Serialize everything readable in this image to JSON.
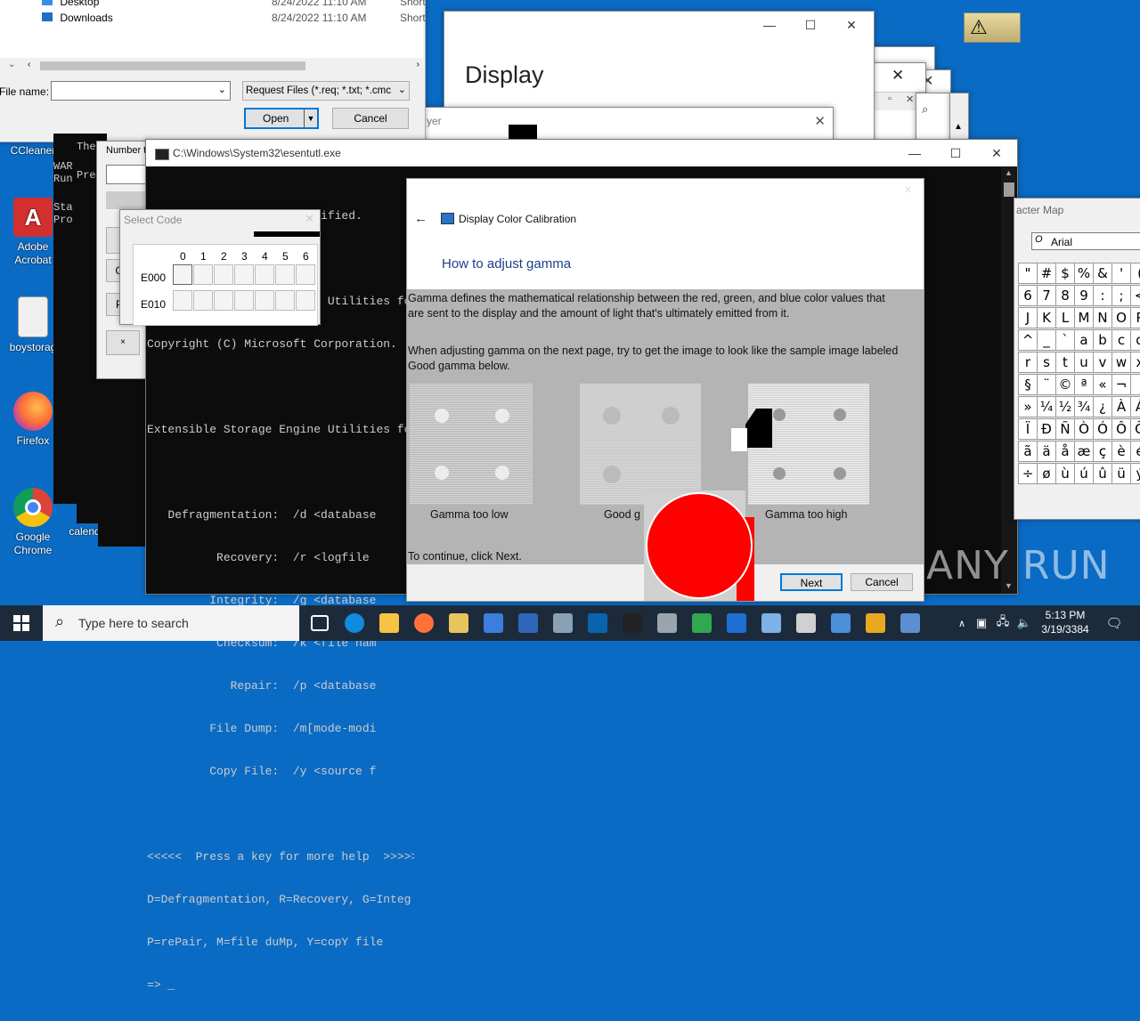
{
  "desktop": {
    "icons": [
      {
        "label": "CCleaner",
        "color": "#c62828"
      },
      {
        "label": "Adobe Acrobat",
        "color": "#d32f2f"
      },
      {
        "label": "boystorag",
        "color": "#e0e0e0"
      },
      {
        "label": "Firefox",
        "color": "#ff7139"
      },
      {
        "label": "Google Chrome",
        "color": "#4caf50"
      },
      {
        "label": "calend",
        "color": "#ffffff"
      }
    ]
  },
  "file_dialog": {
    "rows": [
      {
        "name": "Desktop",
        "date": "8/24/2022 11:10 AM",
        "type": "Short"
      },
      {
        "name": "Downloads",
        "date": "8/24/2022 11:10 AM",
        "type": "Short"
      }
    ],
    "filename_label": "File name:",
    "filename_value": "",
    "filter_value": "Request Files (*.req; *.txt; *.cmc",
    "open_label": "Open",
    "cancel_label": "Cancel"
  },
  "display_window": {
    "title": "Display",
    "search_text": "yer"
  },
  "cmd_window": {
    "title": "C:\\Windows\\System32\\esentutl.exe",
    "lines": [
      "Usage Error: No mode specified.",
      "",
      "Extensible Storage Engine Utilities for",
      "Copyright (C) Microsoft Corporation.",
      "",
      "Extensible Storage Engine Utilities for",
      "",
      "   Defragmentation:  /d <database",
      "          Recovery:  /r <logfile",
      "         Integrity:  /g <database",
      "          Checksum:  /k <file nam",
      "            Repair:  /p <database",
      "         File Dump:  /m[mode-modi",
      "         Copy File:  /y <source f",
      "",
      "<<<<<  Press a key for more help  >>>>>",
      "D=Defragmentation, R=Recovery, G=Integ",
      "P=rePair, M=file duMp, Y=copY file",
      "=> _"
    ]
  },
  "back_console": {
    "lines": [
      "The",
      "WAR",
      "Run",
      "",
      "Sta",
      "Pro"
    ],
    "lines2": [
      "Pre"
    ]
  },
  "number_window": {
    "label": "Number t"
  },
  "select_code": {
    "title": "Select Code",
    "columns": [
      "0",
      "1",
      "2",
      "3",
      "4",
      "5",
      "6"
    ],
    "rows": [
      "E000",
      "E010"
    ]
  },
  "calibration": {
    "title": "Display Color Calibration",
    "heading": "How to adjust gamma",
    "para1": "Gamma defines the mathematical relationship between the red, green, and blue color values that are sent to the display and the amount of light that's ultimately emitted from it.",
    "para2": "When adjusting gamma on the next page, try to get the image to look like the sample image labeled Good gamma below.",
    "samples": [
      {
        "label": "Gamma too low"
      },
      {
        "label": "Good g"
      },
      {
        "label": "Gamma too high"
      }
    ],
    "continue_text": "To continue, click Next.",
    "next_label": "Next",
    "cancel_label": "Cancel"
  },
  "charmap": {
    "title": "acter Map",
    "font": "Arial",
    "rows": [
      [
        "\"",
        "#",
        "$",
        "%",
        "&",
        "'",
        "("
      ],
      [
        "6",
        "7",
        "8",
        "9",
        ":",
        ";",
        "<"
      ],
      [
        "J",
        "K",
        "L",
        "M",
        "N",
        "O",
        "P"
      ],
      [
        "^",
        "_",
        "`",
        "a",
        "b",
        "c",
        "d"
      ],
      [
        "r",
        "s",
        "t",
        "u",
        "v",
        "w",
        "x"
      ],
      [
        "§",
        "¨",
        "©",
        "ª",
        "«",
        "¬",
        "­"
      ],
      [
        "»",
        "¼",
        "½",
        "¾",
        "¿",
        "À",
        "Á"
      ],
      [
        "Ï",
        "Ð",
        "Ñ",
        "Ò",
        "Ó",
        "Ô",
        "Õ"
      ],
      [
        "ã",
        "ä",
        "å",
        "æ",
        "ç",
        "è",
        "é"
      ],
      [
        "÷",
        "ø",
        "ù",
        "ú",
        "û",
        "ü",
        "ý"
      ]
    ]
  },
  "watermark": "ANY RUN",
  "taskbar": {
    "search_placeholder": "Type here to search",
    "time": "5:13 PM",
    "date": "3/19/3384",
    "apps": [
      "task-view",
      "edge",
      "file-explorer",
      "firefox",
      "keys",
      "window",
      "window2",
      "tool",
      "outlook",
      "terminal",
      "scanner",
      "puzzle",
      "display",
      "app",
      "gear",
      "monitor",
      "key",
      "control-panel"
    ]
  }
}
